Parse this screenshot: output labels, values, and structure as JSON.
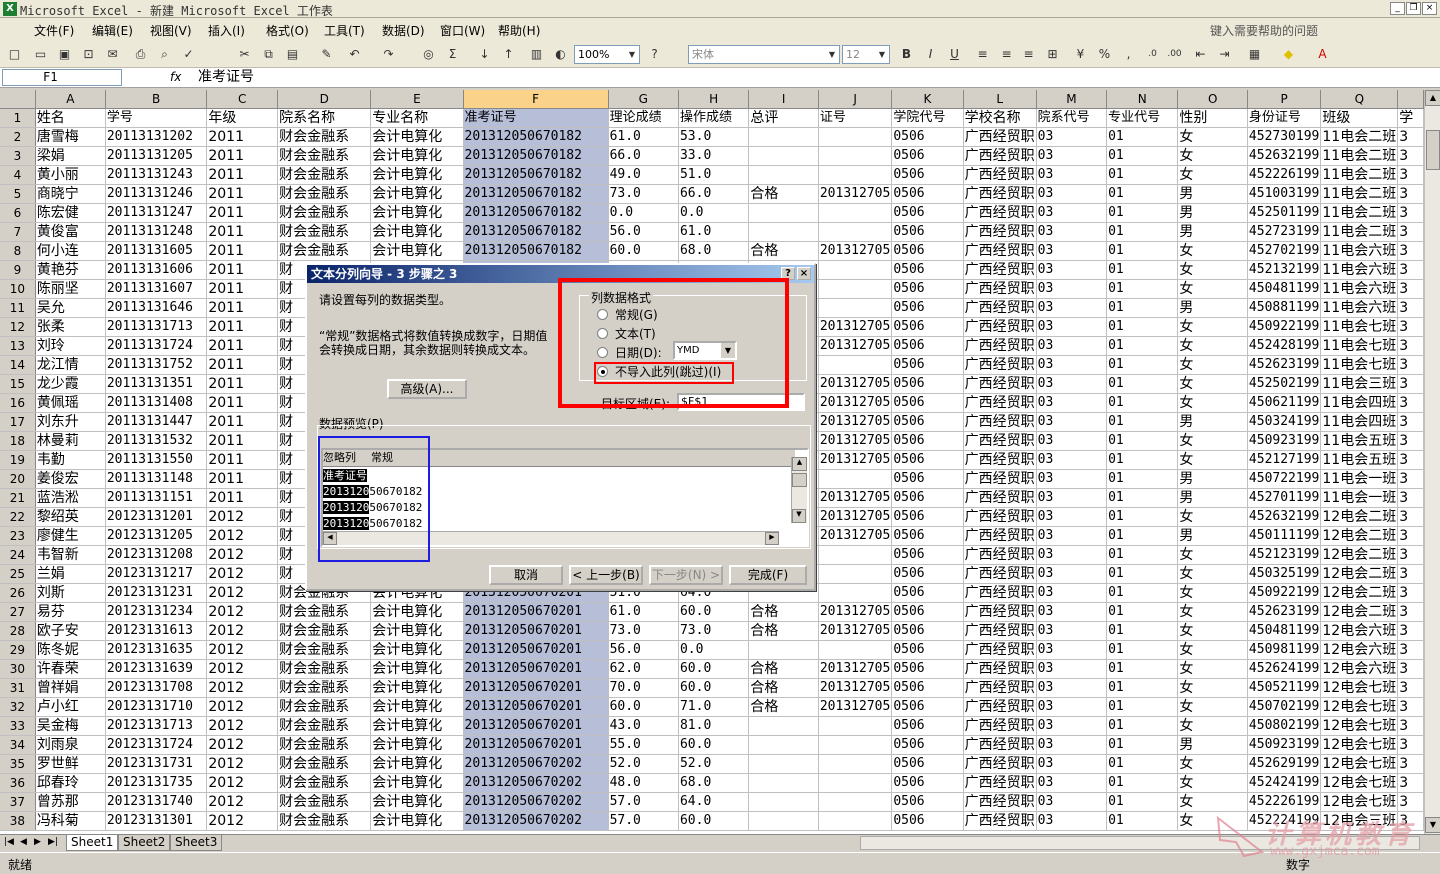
{
  "window": {
    "title": "Microsoft Excel - 新建 Microsoft Excel 工作表",
    "app_icon": "excel-icon"
  },
  "menu": [
    "文件(F)",
    "编辑(E)",
    "视图(V)",
    "插入(I)",
    "格式(O)",
    "工具(T)",
    "数据(D)",
    "窗口(W)",
    "帮助(H)"
  ],
  "help_placeholder": "键入需要帮助的问题",
  "toolbar": {
    "zoom": "100%",
    "font_name": "宋体",
    "font_size": "12"
  },
  "formula_bar": {
    "name_box": "F1",
    "fx": "fx",
    "content": "准考证号"
  },
  "columns": [
    "A",
    "B",
    "C",
    "D",
    "E",
    "F",
    "G",
    "H",
    "I",
    "J",
    "K",
    "L",
    "M",
    "N",
    "O",
    "P",
    "Q"
  ],
  "selected_column": "F",
  "headers": [
    "姓名",
    "学号",
    "年级",
    "院系名称",
    "专业名称",
    "准考证号",
    "理论成绩",
    "操作成绩",
    "总评",
    "证号",
    "学院代号",
    "学校名称",
    "院系代号",
    "专业代号",
    "性别",
    "身份证号",
    "班级",
    "学"
  ],
  "rows": [
    [
      "唐雪梅",
      "20113131202",
      "2011",
      "财会金融系",
      "会计电算化",
      "201312050670182",
      "61.0",
      "53.0",
      "",
      "",
      "0506",
      "广西经贸职",
      "03",
      "01",
      "女",
      "452730199",
      "11电会二班",
      "3"
    ],
    [
      "梁娟",
      "20113131205",
      "2011",
      "财会金融系",
      "会计电算化",
      "201312050670182",
      "66.0",
      "33.0",
      "",
      "",
      "0506",
      "广西经贸职",
      "03",
      "01",
      "女",
      "452632199",
      "11电会二班",
      "3"
    ],
    [
      "黄小丽",
      "20113131243",
      "2011",
      "财会金融系",
      "会计电算化",
      "201312050670182",
      "49.0",
      "51.0",
      "",
      "",
      "0506",
      "广西经贸职",
      "03",
      "01",
      "女",
      "452226199",
      "11电会二班",
      "3"
    ],
    [
      "商晓宁",
      "20113131246",
      "2011",
      "财会金融系",
      "会计电算化",
      "201312050670182",
      "73.0",
      "66.0",
      "合格",
      "201312705",
      "0506",
      "广西经贸职",
      "03",
      "01",
      "男",
      "451003199",
      "11电会二班",
      "3"
    ],
    [
      "陈宏健",
      "20113131247",
      "2011",
      "财会金融系",
      "会计电算化",
      "201312050670182",
      "0.0",
      "0.0",
      "",
      "",
      "0506",
      "广西经贸职",
      "03",
      "01",
      "男",
      "452501199",
      "11电会二班",
      "3"
    ],
    [
      "黄俊富",
      "20113131248",
      "2011",
      "财会金融系",
      "会计电算化",
      "201312050670182",
      "56.0",
      "61.0",
      "",
      "",
      "0506",
      "广西经贸职",
      "03",
      "01",
      "男",
      "452723199",
      "11电会二班",
      "3"
    ],
    [
      "何小连",
      "20113131605",
      "2011",
      "财会金融系",
      "会计电算化",
      "201312050670182",
      "60.0",
      "68.0",
      "合格",
      "201312705",
      "0506",
      "广西经贸职",
      "03",
      "01",
      "女",
      "452702199",
      "11电会六班",
      "3"
    ],
    [
      "黄艳芬",
      "20113131606",
      "2011",
      "财",
      "",
      "",
      "",
      "",
      "",
      "",
      "0506",
      "广西经贸职",
      "03",
      "01",
      "女",
      "452132199",
      "11电会六班",
      "3"
    ],
    [
      "陈丽坚",
      "20113131607",
      "2011",
      "财",
      "",
      "",
      "",
      "",
      "",
      "",
      "0506",
      "广西经贸职",
      "03",
      "01",
      "女",
      "450481199",
      "11电会六班",
      "3"
    ],
    [
      "吴允",
      "20113131646",
      "2011",
      "财",
      "",
      "",
      "",
      "",
      "",
      "",
      "0506",
      "广西经贸职",
      "03",
      "01",
      "男",
      "450881199",
      "11电会六班",
      "3"
    ],
    [
      "张柔",
      "20113131713",
      "2011",
      "财",
      "",
      "",
      "",
      "",
      "",
      "201312705",
      "0506",
      "广西经贸职",
      "03",
      "01",
      "女",
      "450922199",
      "11电会七班",
      "3"
    ],
    [
      "刘玲",
      "20113131724",
      "2011",
      "财",
      "",
      "",
      "",
      "",
      "",
      "201312705",
      "0506",
      "广西经贸职",
      "03",
      "01",
      "女",
      "452428199",
      "11电会七班",
      "3"
    ],
    [
      "龙江情",
      "20113131752",
      "2011",
      "财",
      "",
      "",
      "",
      "",
      "",
      "",
      "0506",
      "广西经贸职",
      "03",
      "01",
      "女",
      "452623199",
      "11电会七班",
      "3"
    ],
    [
      "龙少霞",
      "20113131351",
      "2011",
      "财",
      "",
      "",
      "",
      "",
      "",
      "201312705",
      "0506",
      "广西经贸职",
      "03",
      "01",
      "女",
      "452502199",
      "11电会三班",
      "3"
    ],
    [
      "黄佩瑶",
      "20113131408",
      "2011",
      "财",
      "",
      "",
      "",
      "",
      "",
      "201312705",
      "0506",
      "广西经贸职",
      "03",
      "01",
      "女",
      "450621199",
      "11电会四班",
      "3"
    ],
    [
      "刘东升",
      "20113131447",
      "2011",
      "财",
      "",
      "",
      "",
      "",
      "",
      "201312705",
      "0506",
      "广西经贸职",
      "03",
      "01",
      "男",
      "450324199",
      "11电会四班",
      "3"
    ],
    [
      "林曼莉",
      "20113131532",
      "2011",
      "财",
      "",
      "",
      "",
      "",
      "",
      "201312705",
      "0506",
      "广西经贸职",
      "03",
      "01",
      "女",
      "450923199",
      "11电会五班",
      "3"
    ],
    [
      "韦勤",
      "20113131550",
      "2011",
      "财",
      "",
      "",
      "",
      "",
      "",
      "201312705",
      "0506",
      "广西经贸职",
      "03",
      "01",
      "女",
      "452127199",
      "11电会五班",
      "3"
    ],
    [
      "姜俊宏",
      "20113131148",
      "2011",
      "财",
      "",
      "",
      "",
      "",
      "",
      "",
      "0506",
      "广西经贸职",
      "03",
      "01",
      "男",
      "450722199",
      "11电会一班",
      "3"
    ],
    [
      "蓝浩淞",
      "20113131151",
      "2011",
      "财",
      "",
      "",
      "",
      "",
      "",
      "201312705",
      "0506",
      "广西经贸职",
      "03",
      "01",
      "男",
      "452701199",
      "11电会一班",
      "3"
    ],
    [
      "黎绍英",
      "20123131201",
      "2012",
      "财",
      "",
      "",
      "",
      "",
      "",
      "201312705",
      "0506",
      "广西经贸职",
      "03",
      "01",
      "女",
      "452632199",
      "12电会二班",
      "3"
    ],
    [
      "廖健生",
      "20123131205",
      "2012",
      "财",
      "",
      "",
      "",
      "",
      "",
      "201312705",
      "0506",
      "广西经贸职",
      "03",
      "01",
      "男",
      "450111199",
      "12电会二班",
      "3"
    ],
    [
      "韦智新",
      "20123131208",
      "2012",
      "财",
      "",
      "",
      "",
      "",
      "",
      "",
      "0506",
      "广西经贸职",
      "03",
      "01",
      "女",
      "452123199",
      "12电会二班",
      "3"
    ],
    [
      "兰娟",
      "20123131217",
      "2012",
      "财",
      "",
      "",
      "",
      "",
      "",
      "",
      "0506",
      "广西经贸职",
      "03",
      "01",
      "女",
      "450325199",
      "12电会二班",
      "3"
    ],
    [
      "刘斯",
      "20123131231",
      "2012",
      "财会金融系",
      "会计电算化",
      "201312050670201",
      "51.0",
      "64.0",
      "",
      "",
      "0506",
      "广西经贸职",
      "03",
      "01",
      "女",
      "450922199",
      "12电会二班",
      "3"
    ],
    [
      "易芬",
      "20123131234",
      "2012",
      "财会金融系",
      "会计电算化",
      "201312050670201",
      "61.0",
      "60.0",
      "合格",
      "201312705",
      "0506",
      "广西经贸职",
      "03",
      "01",
      "女",
      "452623199",
      "12电会二班",
      "3"
    ],
    [
      "欧子安",
      "20123131613",
      "2012",
      "财会金融系",
      "会计电算化",
      "201312050670201",
      "73.0",
      "73.0",
      "合格",
      "201312705",
      "0506",
      "广西经贸职",
      "03",
      "01",
      "女",
      "450481199",
      "12电会六班",
      "3"
    ],
    [
      "陈冬妮",
      "20123131635",
      "2012",
      "财会金融系",
      "会计电算化",
      "201312050670201",
      "56.0",
      "0.0",
      "",
      "",
      "0506",
      "广西经贸职",
      "03",
      "01",
      "女",
      "450981199",
      "12电会六班",
      "3"
    ],
    [
      "许春荣",
      "20123131639",
      "2012",
      "财会金融系",
      "会计电算化",
      "201312050670201",
      "62.0",
      "60.0",
      "合格",
      "201312705",
      "0506",
      "广西经贸职",
      "03",
      "01",
      "女",
      "452624199",
      "12电会六班",
      "3"
    ],
    [
      "曾祥娟",
      "20123131708",
      "2012",
      "财会金融系",
      "会计电算化",
      "201312050670201",
      "70.0",
      "60.0",
      "合格",
      "201312705",
      "0506",
      "广西经贸职",
      "03",
      "01",
      "女",
      "450521199",
      "12电会七班",
      "3"
    ],
    [
      "卢小红",
      "20123131710",
      "2012",
      "财会金融系",
      "会计电算化",
      "201312050670201",
      "60.0",
      "71.0",
      "合格",
      "201312705",
      "0506",
      "广西经贸职",
      "03",
      "01",
      "女",
      "450702199",
      "12电会七班",
      "3"
    ],
    [
      "吴金梅",
      "20123131713",
      "2012",
      "财会金融系",
      "会计电算化",
      "201312050670201",
      "43.0",
      "81.0",
      "",
      "",
      "0506",
      "广西经贸职",
      "03",
      "01",
      "女",
      "450802199",
      "12电会七班",
      "3"
    ],
    [
      "刘雨泉",
      "20123131724",
      "2012",
      "财会金融系",
      "会计电算化",
      "201312050670201",
      "55.0",
      "60.0",
      "",
      "",
      "0506",
      "广西经贸职",
      "03",
      "01",
      "男",
      "450923199",
      "12电会七班",
      "3"
    ],
    [
      "罗世鲜",
      "20123131731",
      "2012",
      "财会金融系",
      "会计电算化",
      "201312050670202",
      "52.0",
      "52.0",
      "",
      "",
      "0506",
      "广西经贸职",
      "03",
      "01",
      "女",
      "452629199",
      "12电会七班",
      "3"
    ],
    [
      "邱春玲",
      "20123131735",
      "2012",
      "财会金融系",
      "会计电算化",
      "201312050670202",
      "48.0",
      "68.0",
      "",
      "",
      "0506",
      "广西经贸职",
      "03",
      "01",
      "女",
      "452424199",
      "12电会七班",
      "3"
    ],
    [
      "曾苏那",
      "20123131740",
      "2012",
      "财会金融系",
      "会计电算化",
      "201312050670202",
      "57.0",
      "64.0",
      "",
      "",
      "0506",
      "广西经贸职",
      "03",
      "01",
      "女",
      "452226199",
      "12电会七班",
      "3"
    ],
    [
      "冯科菊",
      "20123131301",
      "2012",
      "财会金融系",
      "会计电算化",
      "201312050670202",
      "57.0",
      "60.0",
      "",
      "",
      "0506",
      "广西经贸职",
      "03",
      "01",
      "女",
      "452224199",
      "12电会三班",
      "3"
    ]
  ],
  "f_full": [
    "201312050670182",
    "201312050670182",
    "201312050670182",
    "201312050670182",
    "201312050670182",
    "201312050670182",
    "201312050670182"
  ],
  "dialog": {
    "title": "文本分列向导 - 3 步骤之 3",
    "instruction": "请设置每列的数据类型。",
    "description1": "“常规”数据格式将数值转换成数字，日期值",
    "description2": "会转换成日期，其余数据则转换成文本。",
    "advanced_btn": "高级(A)...",
    "group_label": "列数据格式",
    "options": [
      "常规(G)",
      "文本(T)",
      "日期(D):",
      "不导入此列(跳过)(I)"
    ],
    "selected_option": 3,
    "date_format": "YMD",
    "target_label": "目标区域(E):",
    "target_value": "$F$1",
    "preview_label": "数据预览(P)",
    "preview_headers": [
      "忽略列",
      "常规"
    ],
    "preview_rows": [
      [
        "准考证号",
        ""
      ],
      [
        "2013120",
        "50670182"
      ],
      [
        "2013120",
        "50670182"
      ],
      [
        "2013120",
        "50670182"
      ]
    ],
    "buttons": {
      "cancel": "取消",
      "back": "< 上一步(B)",
      "next": "下一步(N) >",
      "finish": "完成(F)"
    },
    "help": "?",
    "close": "×"
  },
  "sheet_tabs": [
    "Sheet1",
    "Sheet2",
    "Sheet3"
  ],
  "active_tab": "Sheet1",
  "status": {
    "left": "就绪",
    "right": "数字"
  },
  "watermark": {
    "line1": "计算机教育",
    "line2": "www.gxjmca.com"
  }
}
